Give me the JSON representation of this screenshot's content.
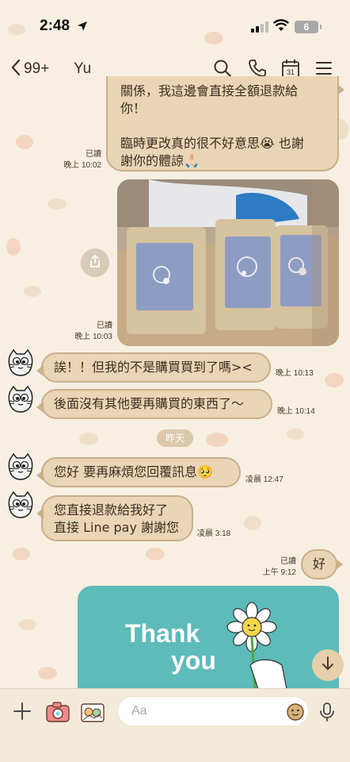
{
  "status_bar": {
    "time": "2:48",
    "battery": "6"
  },
  "header": {
    "unread_count": "99+",
    "contact_name": "Yu"
  },
  "messages": [
    {
      "id": "m1",
      "dir": "out",
      "lines": [
        "關係，我這邊會直接全額退款給",
        "你！",
        "",
        "臨時更改真的很不好意思😭 也謝",
        "謝你的體諒🙏🏻"
      ],
      "read": "已讀",
      "time": "晚上 10:02"
    },
    {
      "id": "m2",
      "dir": "out",
      "type": "photo",
      "read": "已讀",
      "time": "晚上 10:03"
    },
    {
      "id": "m3",
      "dir": "in",
      "text": "誒！！但我的不是購買買到了嗎><",
      "time": "晚上 10:13"
    },
    {
      "id": "m4",
      "dir": "in",
      "text": "後面沒有其他要再購買的東西了～",
      "time": "晚上 10:14"
    },
    {
      "id": "m5",
      "dir": "in",
      "text": "您好 要再麻煩您回覆訊息🥺",
      "time": "凌晨 12:47"
    },
    {
      "id": "m6",
      "dir": "in",
      "lines": [
        "您直接退款給我好了",
        "直接 Line pay 謝謝您"
      ],
      "time": "凌晨 3:18"
    },
    {
      "id": "m7",
      "dir": "out",
      "text": "好",
      "read": "已讀",
      "time": "上午 9:12"
    }
  ],
  "date_separator": "昨天",
  "sticker": {
    "line1": "Thank",
    "line2": "you"
  },
  "input": {
    "placeholder": "Aa"
  },
  "colors": {
    "bubble": "#ead5b6",
    "bubble_border": "#c8b08a",
    "background": "#f7efe2",
    "sticker_bg": "#5dbbb9"
  }
}
